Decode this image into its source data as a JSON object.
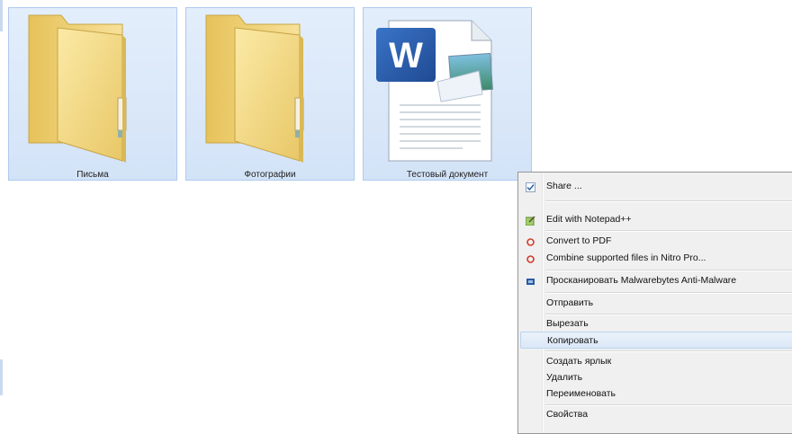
{
  "files": [
    {
      "label": "Письма",
      "icon": "folder-icon"
    },
    {
      "label": "Фотографии",
      "icon": "folder-icon"
    },
    {
      "label": "Тестовый документ",
      "icon": "word-document-icon"
    }
  ],
  "context_menu": {
    "items": [
      {
        "label": "Share ...",
        "icon": "share-check-icon"
      },
      {
        "label": "Edit with Notepad++",
        "icon": "notepadpp-icon"
      },
      {
        "label": "Convert to PDF",
        "icon": "nitro-pdf-icon"
      },
      {
        "label": "Combine supported files in Nitro Pro...",
        "icon": "nitro-pdf-icon"
      },
      {
        "label": "Просканировать Malwarebytes Anti-Malware",
        "icon": "malwarebytes-icon"
      },
      {
        "label": "Отправить"
      },
      {
        "label": "Вырезать"
      },
      {
        "label": "Копировать",
        "highlighted": true
      },
      {
        "label": "Создать ярлык"
      },
      {
        "label": "Удалить"
      },
      {
        "label": "Переименовать"
      },
      {
        "label": "Свойства"
      }
    ]
  },
  "colors": {
    "selection_fill": "#d8e6f8",
    "selection_border": "#aecaee",
    "menu_background": "#f0f0f0",
    "folder_yellow": "#f3d77f",
    "word_blue": "#2f5ea8"
  }
}
